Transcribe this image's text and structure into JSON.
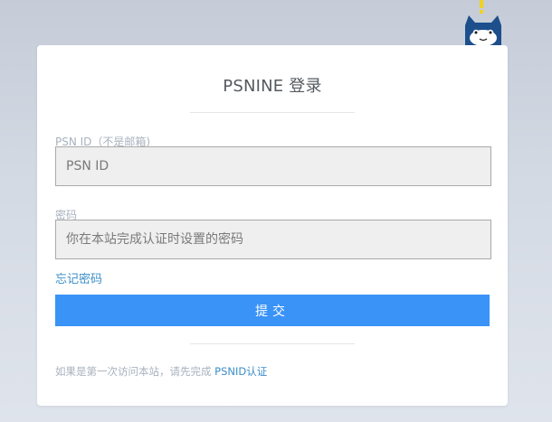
{
  "login": {
    "title": "PSNINE 登录",
    "psn_id": {
      "label": "PSN ID（不是邮箱)",
      "placeholder": "PSN ID"
    },
    "password": {
      "label": "密码",
      "placeholder": "你在本站完成认证时设置的密码"
    },
    "forgot_link": "忘记密码",
    "submit_label": "提交",
    "footer": {
      "text": "如果是第一次访问本站，请先完成 ",
      "link": "PSNID认证"
    }
  },
  "colors": {
    "accent": "#3a93f7",
    "link": "#3b8ec8",
    "label": "#a8b2bf"
  },
  "icons": {
    "mascot": "cat-mascot-icon"
  }
}
